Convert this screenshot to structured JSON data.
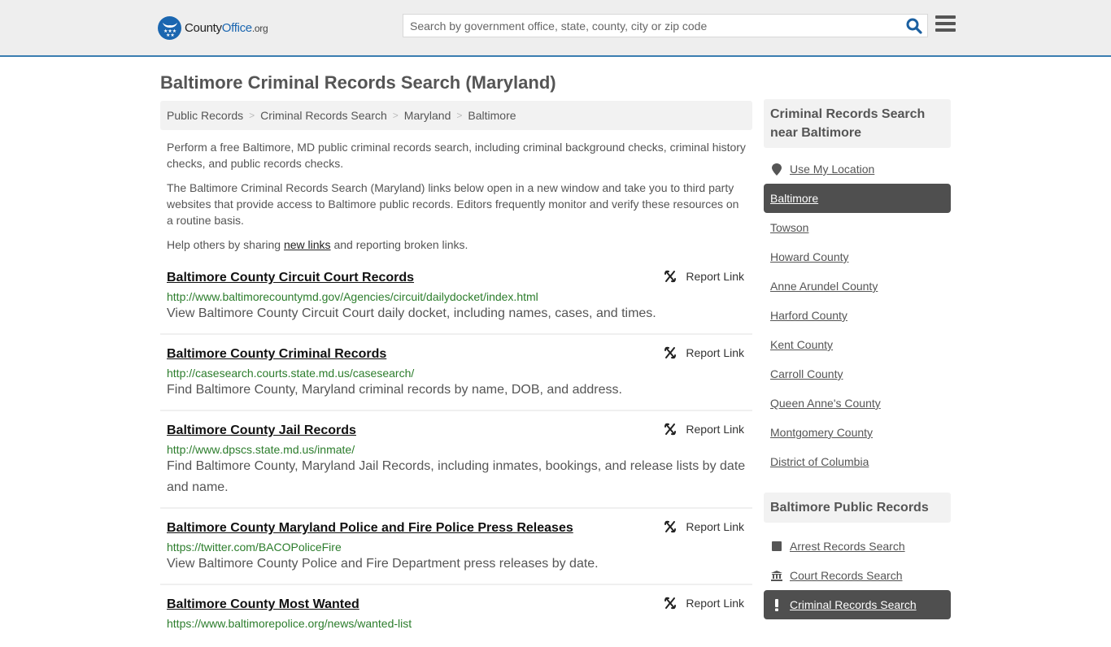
{
  "header": {
    "logo": {
      "county": "County",
      "office": "Office",
      "org": ".org"
    },
    "search_placeholder": "Search by government office, state, county, city or zip code",
    "search_value": ""
  },
  "page_title": "Baltimore Criminal Records Search (Maryland)",
  "breadcrumb": [
    "Public Records",
    "Criminal Records Search",
    "Maryland",
    "Baltimore"
  ],
  "intro": {
    "p1": "Perform a free Baltimore, MD public criminal records search, including criminal background checks, criminal history checks, and public records checks.",
    "p2": "The Baltimore Criminal Records Search (Maryland) links below open in a new window and take you to third party websites that provide access to Baltimore public records. Editors frequently monitor and verify these resources on a routine basis.",
    "p3_before": "Help others by sharing ",
    "p3_link": "new links",
    "p3_after": " and reporting broken links."
  },
  "report_label": "Report Link",
  "results": [
    {
      "title": "Baltimore County Circuit Court Records",
      "url": "http://www.baltimorecountymd.gov/Agencies/circuit/dailydocket/index.html",
      "desc": "View Baltimore County Circuit Court daily docket, including names, cases, and times."
    },
    {
      "title": "Baltimore County Criminal Records",
      "url": "http://casesearch.courts.state.md.us/casesearch/",
      "desc": "Find Baltimore County, Maryland criminal records by name, DOB, and address."
    },
    {
      "title": "Baltimore County Jail Records",
      "url": "http://www.dpscs.state.md.us/inmate/",
      "desc": "Find Baltimore County, Maryland Jail Records, including inmates, bookings, and release lists by date and name."
    },
    {
      "title": "Baltimore County Maryland Police and Fire Police Press Releases",
      "url": "https://twitter.com/BACOPoliceFire",
      "desc": "View Baltimore County Police and Fire Department press releases by date."
    },
    {
      "title": "Baltimore County Most Wanted",
      "url": "https://www.baltimorepolice.org/news/wanted-list",
      "desc": ""
    }
  ],
  "sidebar": {
    "nearby_heading": "Criminal Records Search near Baltimore",
    "use_location": "Use My Location",
    "nearby": [
      "Baltimore",
      "Towson",
      "Howard County",
      "Anne Arundel County",
      "Harford County",
      "Kent County",
      "Carroll County",
      "Queen Anne's County",
      "Montgomery County",
      "District of Columbia"
    ],
    "nearby_active": "Baltimore",
    "public_heading": "Baltimore Public Records",
    "public_records": [
      {
        "label": "Arrest Records Search",
        "icon": "square-icon"
      },
      {
        "label": "Court Records Search",
        "icon": "courthouse-icon"
      },
      {
        "label": "Criminal Records Search",
        "icon": "exclamation-icon",
        "active": true
      }
    ]
  }
}
